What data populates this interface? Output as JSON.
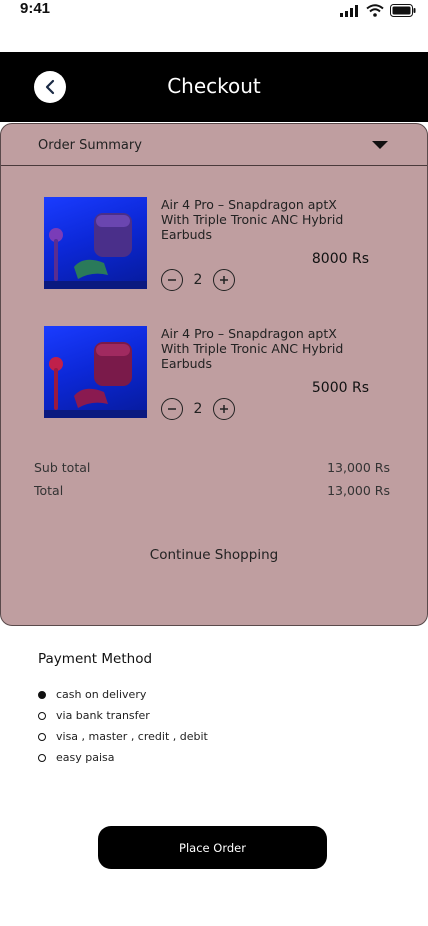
{
  "status_bar": {
    "time": "9:41"
  },
  "header": {
    "title": "Checkout"
  },
  "order_summary": {
    "title": "Order Summary",
    "items": [
      {
        "name": "Air 4 Pro  – Snapdragon aptX With Triple Tronic ANC Hybrid Earbuds",
        "quantity": "2",
        "price": "8000  Rs",
        "image_accent": "#5b2a8a"
      },
      {
        "name": "Air 4 Pro  – Snapdragon aptX With Triple Tronic ANC Hybrid Earbuds",
        "quantity": "2",
        "price": "5000  Rs",
        "image_accent": "#b3124a"
      }
    ],
    "subtotal_label": "Sub total",
    "subtotal_value": "13,000 Rs",
    "total_label": "Total",
    "total_value": "13,000 Rs",
    "continue_label": "Continue Shopping"
  },
  "payment": {
    "title": "Payment Method",
    "options": [
      {
        "label": "cash on delivery",
        "selected": true
      },
      {
        "label": "via bank transfer",
        "selected": false
      },
      {
        "label": "visa , master , credit , debit",
        "selected": false
      },
      {
        "label": "easy paisa",
        "selected": false
      }
    ]
  },
  "place_order_label": "Place Order",
  "colors": {
    "card_bg": "#bf9ea0",
    "header_bg": "#000000",
    "button_bg": "#000000"
  }
}
